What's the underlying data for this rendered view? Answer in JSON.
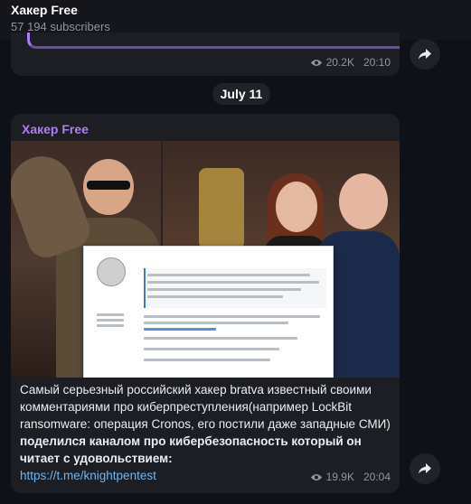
{
  "header": {
    "title": "Хакер Free",
    "subscribers": "57 194 subscribers"
  },
  "prev_post": {
    "views": "20.2K",
    "time": "20:10"
  },
  "date_pill": "July 11",
  "post": {
    "channel": "Хакер Free",
    "caption_regular": "Самый серьезный российский хакер bratva известный своими комментариями про киберпреступления(например LockBit ransomware: операция Cronos, его постили даже западные СМИ)",
    "caption_bold": "поделился каналом про кибербезопасность который он читает с удовольствием:",
    "link": "https://t.me/knightpentest",
    "views": "19.9K",
    "time": "20:04"
  },
  "colors": {
    "accent": "#b07df0",
    "link": "#6fb3ee",
    "bubble": "#1c1e24",
    "background": "#0e1117"
  },
  "icons": [
    "eye-icon",
    "share-icon"
  ]
}
